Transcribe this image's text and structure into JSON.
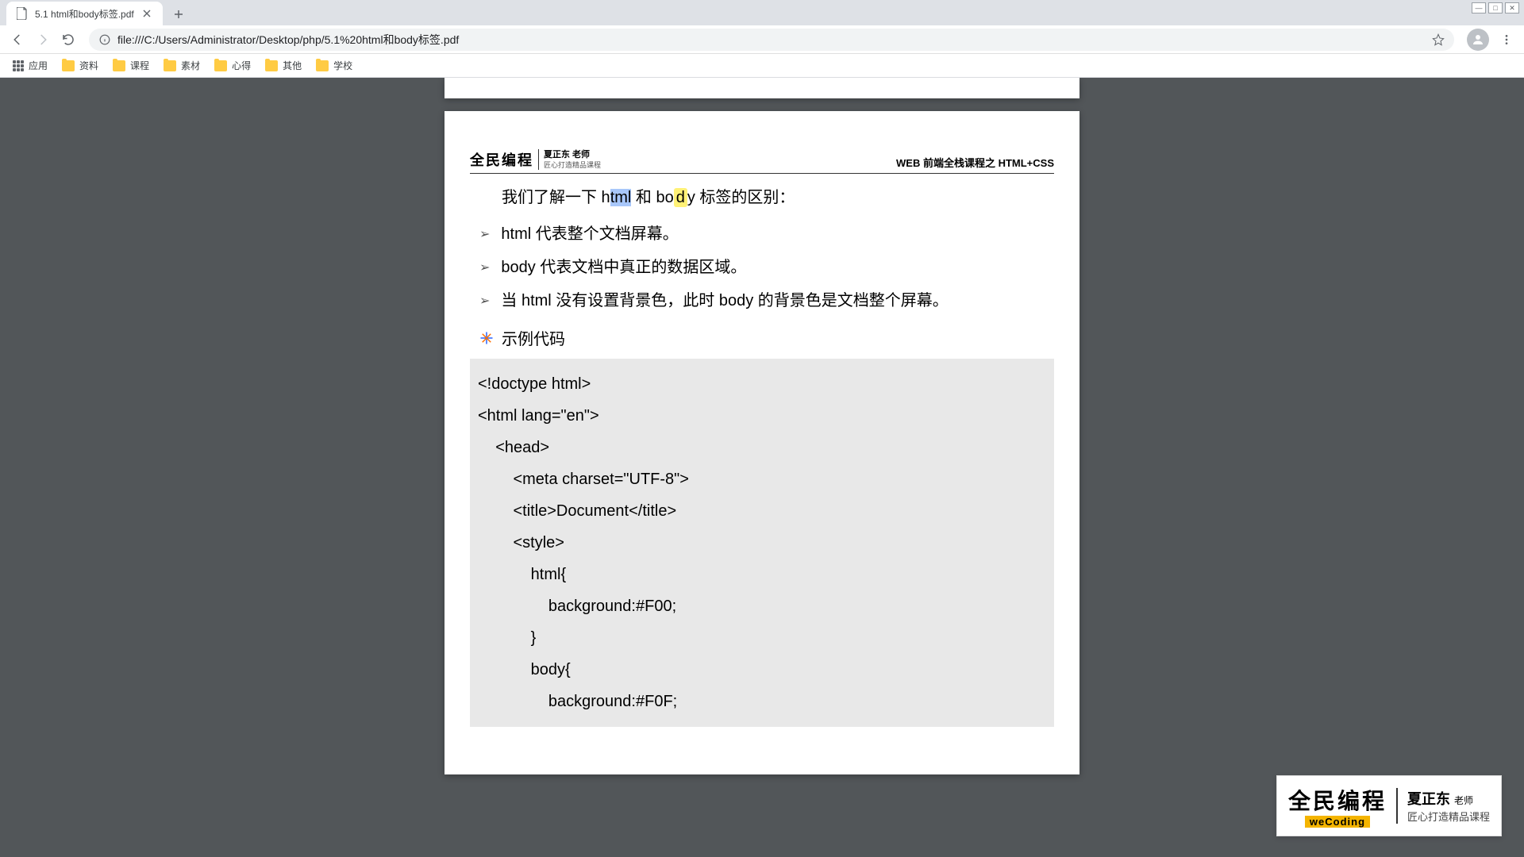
{
  "tab": {
    "title": "5.1 html和body标签.pdf"
  },
  "url": "file:///C:/Users/Administrator/Desktop/php/5.1%20html和body标签.pdf",
  "bookmarks": {
    "apps": "应用",
    "items": [
      "资料",
      "课程",
      "素材",
      "心得",
      "其他",
      "学校"
    ]
  },
  "doc": {
    "logo_brand": "全民编程",
    "logo_sub_name": "夏正东 老师",
    "logo_sub_slogan": "匠心打造精品课程",
    "header_right": "WEB 前端全栈课程之 HTML+CSS",
    "intro_prefix": "我们了解一下 h",
    "intro_sel": "tml",
    "intro_mid": " 和 bo",
    "intro_hl": "d",
    "intro_after_hl": "y",
    "intro_suffix": " 标签的区别：",
    "bullets": [
      "html 代表整个文档屏幕。",
      "body 代表文档中真正的数据区域。",
      "当 html 没有设置背景色，此时 body 的背景色是文档整个屏幕。"
    ],
    "example_label": "示例代码",
    "code": [
      "<!doctype html>",
      "<html lang=\"en\">",
      "    <head>",
      "        <meta charset=\"UTF-8\">",
      "        <title>Document</title>",
      "        <style>",
      "            html{",
      "                background:#F00;",
      "            }",
      "            body{",
      "                background:#F0F;"
    ]
  },
  "watermark": {
    "main": "全民编程",
    "sub": "weCoding",
    "name_strong": "夏正东",
    "name_suffix": "老师",
    "slogan": "匠心打造精品课程"
  }
}
